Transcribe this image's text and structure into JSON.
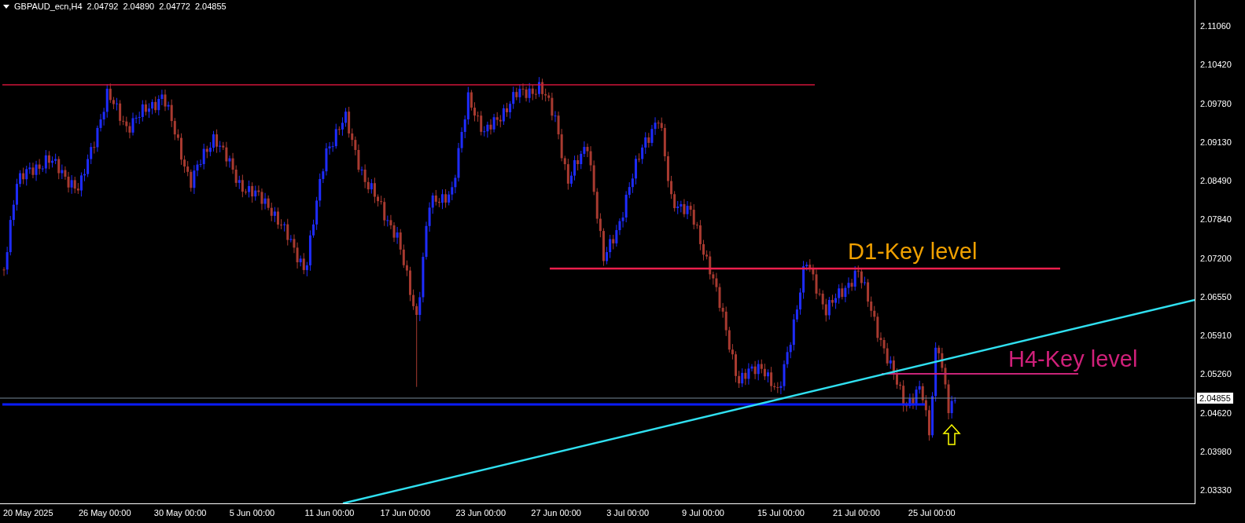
{
  "header": {
    "symbol": "GBPAUD_ecn,H4",
    "quotes": [
      "2.04792",
      "2.04890",
      "2.04772",
      "2.04855"
    ]
  },
  "price_axis": {
    "labels": [
      "2.11060",
      "2.10420",
      "2.09780",
      "2.09130",
      "2.08490",
      "2.07840",
      "2.07200",
      "2.06550",
      "2.05910",
      "2.05260",
      "2.04620",
      "2.03980",
      "2.03330"
    ],
    "current": "2.04855"
  },
  "time_axis": {
    "labels": [
      "20 May 2025",
      "26 May 00:00",
      "30 May 00:00",
      "5 Jun 00:00",
      "11 Jun 00:00",
      "17 Jun 00:00",
      "23 Jun 00:00",
      "27 Jun 00:00",
      "3 Jul 00:00",
      "9 Jul 00:00",
      "15 Jul 00:00",
      "21 Jul 00:00",
      "25 Jul 00:00"
    ]
  },
  "annotations": [
    {
      "kind": "d1",
      "text": "D1-Key level",
      "color": "#f0a000"
    },
    {
      "kind": "h4",
      "text": "H4-Key level",
      "color": "#d0207a"
    }
  ]
}
